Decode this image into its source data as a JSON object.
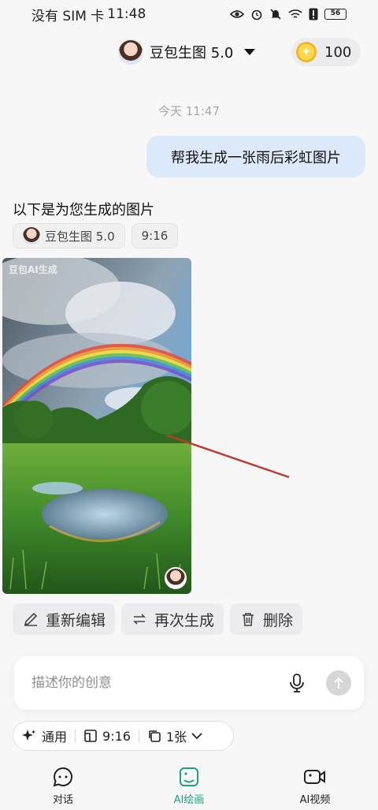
{
  "status_bar": {
    "carrier": "没有 SIM 卡",
    "time": "11:48",
    "battery": "56"
  },
  "header": {
    "model_name": "豆包生图 5.0",
    "coins": "100"
  },
  "chat": {
    "timestamp": "今天 11:47",
    "user_message": "帮我生成一张雨后彩虹图片",
    "reply_text": "以下是为您生成的图片",
    "chips": {
      "model": "豆包生图 5.0",
      "ratio": "9:16"
    },
    "image": {
      "watermark": "豆包AI生成"
    },
    "actions": {
      "edit": "重新编辑",
      "regenerate": "再次生成",
      "delete": "删除"
    }
  },
  "prompt": {
    "placeholder": "描述你的创意"
  },
  "options": {
    "style": "通用",
    "ratio": "9:16",
    "count": "1张"
  },
  "tabs": {
    "chat": "对话",
    "ai_draw": "AI绘画",
    "ai_video": "AI视频"
  },
  "colors": {
    "accent": "#1aa67a",
    "user_bubble": "#dbe9fb",
    "annotation_arrow": "#c0392b"
  }
}
